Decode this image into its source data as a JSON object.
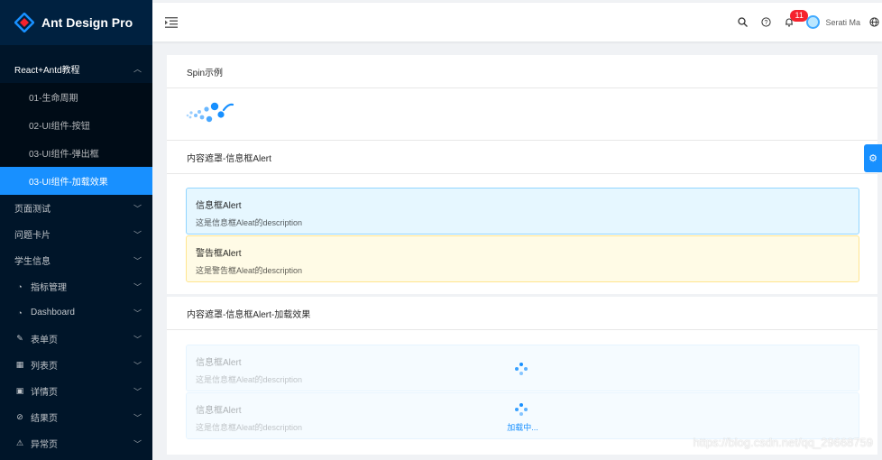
{
  "app": {
    "title": "Ant Design Pro"
  },
  "header": {
    "notification_count": "11",
    "user_name": "Serati Ma"
  },
  "sidebar": {
    "groups": [
      {
        "label": "React+Antd教程",
        "open": true,
        "children": [
          {
            "label": "01-生命周期"
          },
          {
            "label": "02-UI组件-按钮"
          },
          {
            "label": "03-UI组件-弹出框"
          },
          {
            "label": "03-UI组件-加载效果",
            "selected": true
          }
        ]
      }
    ],
    "items": [
      {
        "label": "页面测试",
        "icon": ""
      },
      {
        "label": "问题卡片",
        "icon": ""
      },
      {
        "label": "学生信息",
        "icon": ""
      },
      {
        "label": "指标管理",
        "icon": "dashboard-icon"
      },
      {
        "label": "Dashboard",
        "icon": "dashboard-icon"
      },
      {
        "label": "表单页",
        "icon": "form-icon"
      },
      {
        "label": "列表页",
        "icon": "table-icon"
      },
      {
        "label": "详情页",
        "icon": "profile-icon"
      },
      {
        "label": "结果页",
        "icon": "check-circle-icon"
      },
      {
        "label": "异常页",
        "icon": "warning-icon"
      }
    ]
  },
  "main": {
    "card1": {
      "title": "Spin示例"
    },
    "card2": {
      "title": "内容遮罩-信息框Alert",
      "alerts": [
        {
          "message": "信息框Alert",
          "description": "这是信息框Aleat的description"
        },
        {
          "message": "警告框Alert",
          "description": "这是警告框Aleat的description"
        }
      ]
    },
    "card3": {
      "title": "内容遮罩-信息框Alert-加载效果",
      "alerts": [
        {
          "message": "信息框Alert",
          "description": "这是信息框Aleat的description"
        },
        {
          "message": "信息框Alert",
          "description": "这是信息框Aleat的description"
        }
      ],
      "loading_text": "加载中..."
    }
  },
  "watermark": "https://blog.csdn.net/qq_29668759",
  "colors": {
    "primary": "#1890ff",
    "sider": "#001529",
    "badge": "#f5222d"
  }
}
